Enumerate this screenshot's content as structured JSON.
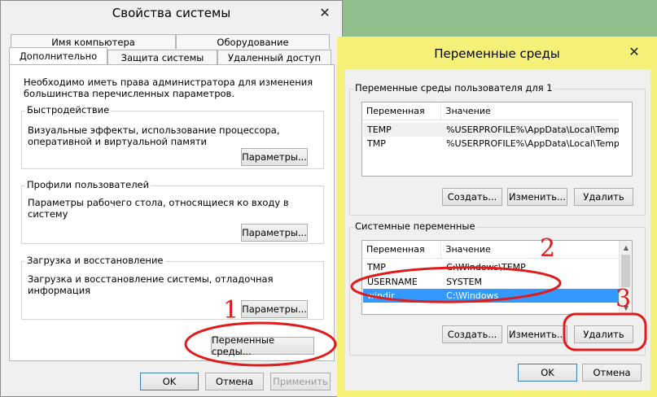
{
  "sysprops": {
    "title": "Свойства системы",
    "tabs_row1": [
      "Имя компьютера",
      "Оборудование"
    ],
    "tabs_row2": [
      "Дополнительно",
      "Защита системы",
      "Удаленный доступ"
    ],
    "admin_note": "Необходимо иметь права администратора для изменения большинства перечисленных параметров.",
    "groups": [
      {
        "title": "Быстродействие",
        "desc": "Визуальные эффекты, использование процессора, оперативной и виртуальной памяти",
        "button": "Параметры..."
      },
      {
        "title": "Профили пользователей",
        "desc": "Параметры рабочего стола, относящиеся ко входу в систему",
        "button": "Параметры..."
      },
      {
        "title": "Загрузка и восстановление",
        "desc": "Загрузка и восстановление системы, отладочная информация",
        "button": "Параметры..."
      }
    ],
    "env_button": "Переменные среды...",
    "ok": "OK",
    "cancel": "Отмена",
    "apply": "Применить"
  },
  "envvars": {
    "title": "Переменные среды",
    "user_group_title": "Переменные среды пользователя для 1",
    "col_var": "Переменная",
    "col_val": "Значение",
    "user_rows": [
      {
        "name": "TEMP",
        "value": "%USERPROFILE%\\AppData\\Local\\Temp"
      },
      {
        "name": "TMP",
        "value": "%USERPROFILE%\\AppData\\Local\\Temp"
      }
    ],
    "sys_group_title": "Системные переменные",
    "sys_rows": [
      {
        "name": "TMP",
        "value": "C:\\Windows\\TEMP"
      },
      {
        "name": "USERNAME",
        "value": "SYSTEM"
      },
      {
        "name": "windir",
        "value": "C:\\Windows"
      }
    ],
    "create": "Создать...",
    "edit": "Изменить...",
    "delete": "Удалить",
    "ok": "OK",
    "cancel": "Отмена"
  },
  "annotations": {
    "n1": "1",
    "n2": "2",
    "n3": "3"
  },
  "colors": {
    "annotation": "#e01b1b",
    "selection": "#3399ff",
    "env_frame": "#f5f078"
  }
}
